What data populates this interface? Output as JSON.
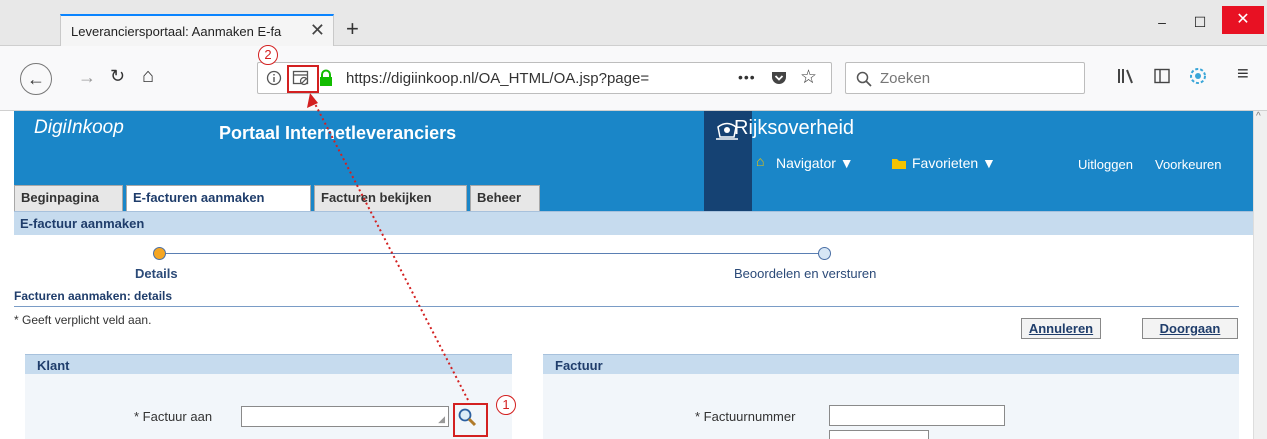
{
  "browser": {
    "tab_title": "Leveranciersportaal: Aanmaken E-fa",
    "tab_close": "✕",
    "new_tab": "+",
    "minimize": "‒",
    "maximize": "☐",
    "close": "✕",
    "back": "←",
    "forward": "→",
    "reload": "↻",
    "home": "⌂",
    "url": "https://digiinkoop.nl/OA_HTML/OA.jsp?page=",
    "page_actions": "•••",
    "search_placeholder": "Zoeken",
    "menu": "≡"
  },
  "header": {
    "brand": "DigiInkoop",
    "portal_title": "Portaal Internetleveranciers",
    "gov_name": "Rijksoverheid",
    "navigator": "Navigator ▼",
    "favorites": "Favorieten ▼",
    "logout": "Uitloggen",
    "preferences": "Voorkeuren"
  },
  "tabs": [
    "Beginpagina",
    "E-facturen aanmaken",
    "Facturen bekijken",
    "Beheer"
  ],
  "subheader": "E-factuur aanmaken",
  "train": {
    "steps": [
      "Details",
      "Beoordelen en versturen"
    ]
  },
  "section": {
    "title": "Facturen aanmaken: details",
    "required_note": "* Geeft verplicht veld aan.",
    "cancel": "Annuleren",
    "continue": "Doorgaan"
  },
  "klant": {
    "title": "Klant",
    "invoice_to_label": "* Factuur aan"
  },
  "factuur": {
    "title": "Factuur",
    "invoice_number_label": "* Factuurnummer"
  },
  "annotations": {
    "marker1": "1",
    "marker2": "2"
  },
  "colors": {
    "header_blue": "#1a86c8",
    "gov_blue": "#154273",
    "annotation_red": "#d32020"
  }
}
